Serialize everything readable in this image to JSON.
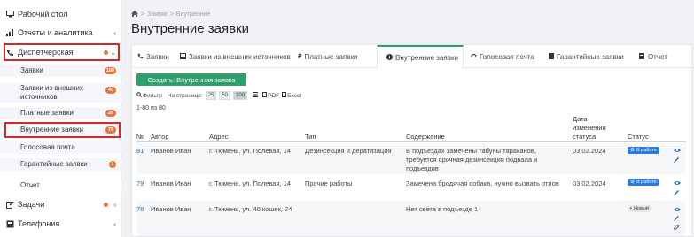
{
  "sidebar": {
    "items": [
      {
        "label": "Рабочий стол",
        "icon": "monitor-icon"
      },
      {
        "label": "Отчеты и аналитика",
        "icon": "bar-chart-icon"
      },
      {
        "label": "Диспетчерская",
        "icon": "phone-icon"
      },
      {
        "label": "Задачи",
        "icon": "edit-icon"
      },
      {
        "label": "Телефония",
        "icon": "phone-book-icon"
      }
    ],
    "sub_items": [
      {
        "label": "Заявки",
        "badge": "180"
      },
      {
        "label": "Заявки из внешних источников",
        "badge": "40"
      },
      {
        "label": "Платные заявки",
        "badge": "28"
      },
      {
        "label": "Внутренние заявки",
        "badge": "79"
      },
      {
        "label": "Голосовая почта",
        "badge": ""
      },
      {
        "label": "Гарантийные заявки",
        "badge": "1"
      },
      {
        "label": "Отчет",
        "badge": ""
      }
    ]
  },
  "breadcrumb": {
    "home": "⌂",
    "sep": ">",
    "level1": "Заявки",
    "level2": "Внутренние"
  },
  "page_title": "Внутренние заявки",
  "tabs": [
    {
      "label": "Заявки",
      "icon": "phone-icon"
    },
    {
      "label": "Заявки из внешних источников",
      "icon": "inbox-icon"
    },
    {
      "label": "Платные заявки",
      "icon": "money-icon"
    },
    {
      "label": "Внутренние заявки",
      "icon": "info-icon"
    },
    {
      "label": "Голосовая почта",
      "icon": "voicemail-icon"
    },
    {
      "label": "Гарантийные заявки",
      "icon": "book-icon"
    },
    {
      "label": "Отчет",
      "icon": "report-icon"
    }
  ],
  "create_button": "Создать: Внутренняя заявка",
  "toolbar": {
    "filter": "Фильтр",
    "per_page": "На странице:",
    "pages": [
      "25",
      "50",
      "100"
    ],
    "pdf": "PDF",
    "excel": "Excel"
  },
  "count": "1-80 из 80",
  "columns": {
    "num": "№",
    "author": "Автор",
    "address": "Адрес",
    "type": "Тип",
    "content": "Содержание",
    "date_l1": "Дата",
    "date_l2": "изменения",
    "date_l3": "статуса",
    "status": "Статус"
  },
  "rows": [
    {
      "id": "81",
      "author": "Иванов Иван",
      "address": "г. Тюмень, ул. Полевая, 14",
      "type": "Дезинсекция и дератизация",
      "content_l1": "В подъездах замечены табуны тараканов,",
      "content_l2": "требуется срочная дезинсекция подвала и",
      "content_l3": "подъездов",
      "date": "03.02.2024",
      "status": "В работе"
    },
    {
      "id": "79",
      "author": "Иванов Иван",
      "address": "г. Тюмень, ул. Полевая, 14",
      "type": "Прочие работы",
      "content_l1": "Замечена бродячая собака, нужно вызвать отлов",
      "content_l2": "",
      "content_l3": "",
      "date": "03.02.2024",
      "status": "В работе"
    },
    {
      "id": "78",
      "author": "Иванов Иван",
      "address": "г. Тюмень, ул. 40 кошек, 24",
      "type": "",
      "content_l1": "Нет света в подъезде 1",
      "content_l2": "",
      "content_l3": "",
      "date": "",
      "status": "Новый"
    }
  ],
  "colors": {
    "accent": "#2e9e6b",
    "badge": "#e8753a",
    "highlight": "#d62828",
    "status_work": "#2c7be5"
  }
}
